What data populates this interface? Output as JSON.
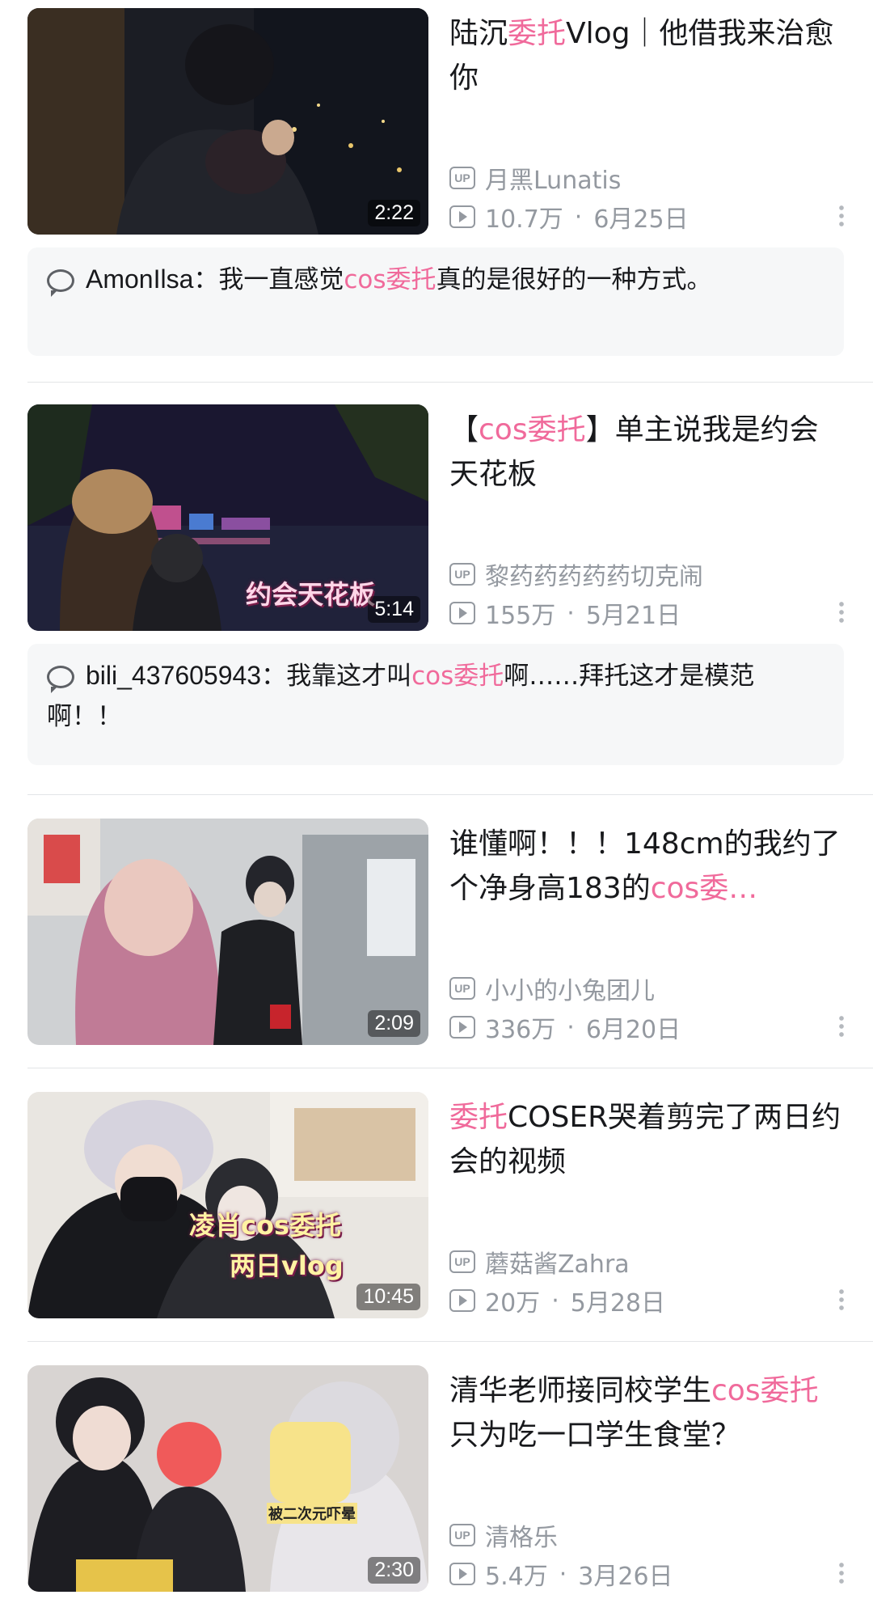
{
  "videos": [
    {
      "title_parts": [
        "陆沉",
        "委托",
        "Vlog｜他借我来治愈你"
      ],
      "uploader": "月黑Lunatis",
      "views": "10.7万",
      "date": "6月25日",
      "duration": "2:22",
      "comment": {
        "user": "AmonIlsa",
        "pre": "：我一直感觉",
        "hl": "cos委托",
        "post": "真的是很好的一种方式。"
      }
    },
    {
      "title_parts": [
        "【",
        "cos委托",
        "】单主说我是约会天花板"
      ],
      "uploader": "黎药药药药药切克闹",
      "views": "155万",
      "date": "5月21日",
      "duration": "5:14",
      "overlay": "约会天花板",
      "comment": {
        "user": "bili_437605943",
        "pre": "：我靠这才叫",
        "hl": "cos委托",
        "post": "啊……拜托这才是模范啊！！"
      }
    },
    {
      "title_parts": [
        "谁懂啊！！！148cm的我约了个净身高183的",
        "cos委…",
        ""
      ],
      "uploader": "小小的小兔团儿",
      "views": "336万",
      "date": "6月20日",
      "duration": "2:09"
    },
    {
      "title_parts": [
        "",
        "委托",
        "COSER哭着剪完了两日约会的视频"
      ],
      "uploader": "蘑菇酱Zahra",
      "views": "20万",
      "date": "5月28日",
      "duration": "10:45",
      "overlay": "凌肖cos委托",
      "overlay2": "两日vlog"
    },
    {
      "title_parts": [
        "清华老师接同校学生",
        "cos委托",
        "只为吃一口学生食堂？"
      ],
      "uploader": "清格乐",
      "views": "5.4万",
      "date": "3月26日",
      "duration": "2:30",
      "overlay": "被二次元吓晕"
    }
  ],
  "icons": {
    "up": "UP",
    "play": "play-count-icon",
    "comment": "comment-bubble-icon",
    "more": "more-vertical-icon"
  },
  "separator": "·",
  "accent": "#f06a9b"
}
